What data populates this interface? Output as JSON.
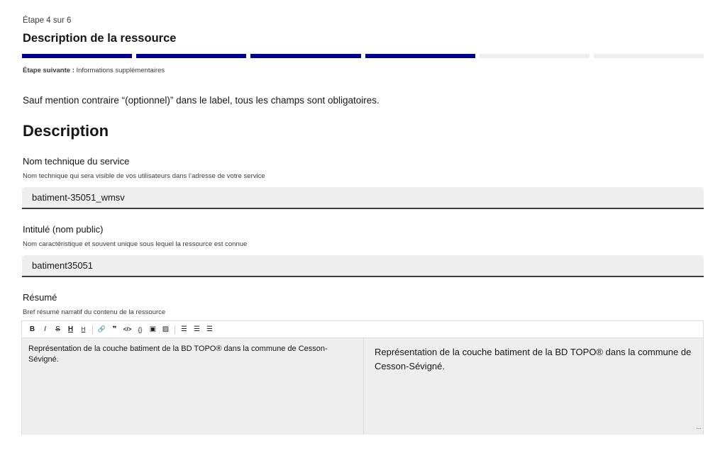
{
  "stepper": {
    "step_label": "Étape 4 sur 6",
    "title": "Description de la ressource",
    "bars": [
      {
        "state": "done"
      },
      {
        "state": "done"
      },
      {
        "state": "done"
      },
      {
        "state": "done"
      },
      {
        "state": "todo"
      },
      {
        "state": "todo"
      }
    ],
    "next_label": "Étape suivante :",
    "next_value": " Informations supplémentaires"
  },
  "mandatory_note": "Sauf mention contraire “(optionnel)” dans le label, tous les champs sont obligatoires.",
  "section_title": "Description",
  "fields": {
    "technical_name": {
      "label": "Nom technique du service",
      "hint": "Nom technique qui sera visible de vos utilisateurs dans l’adresse de votre service",
      "value": "batiment-35051_wmsv"
    },
    "public_title": {
      "label": "Intitulé (nom public)",
      "hint": "Nom caractéristique et souvent unique sous lequel la ressource est connue",
      "value": "batiment35051"
    },
    "summary": {
      "label": "Résumé",
      "hint": "Bref résumé narratif du contenu de la ressource",
      "source_text": "Représentation de la couche batiment de la BD TOPO® dans la commune de Cesson-Sévigné.",
      "preview_text": "Représentation de la couche batiment de la BD TOPO® dans la commune de Cesson-Sévigné."
    }
  },
  "editor_toolbar": [
    {
      "name": "bold-icon",
      "glyph": "B"
    },
    {
      "name": "italic-icon",
      "glyph": "I"
    },
    {
      "name": "strikethrough-icon",
      "glyph": "S"
    },
    {
      "name": "heading-icon",
      "glyph": "H"
    },
    {
      "name": "heading-small-icon",
      "glyph": "H"
    },
    {
      "name": "link-icon",
      "glyph": "🔗"
    },
    {
      "name": "quote-icon",
      "glyph": "❞"
    },
    {
      "name": "code-icon",
      "glyph": "</>"
    },
    {
      "name": "code-block-icon",
      "glyph": "{}"
    },
    {
      "name": "embed-icon",
      "glyph": "▣"
    },
    {
      "name": "image-icon",
      "glyph": "▨"
    },
    {
      "name": "bullet-list-icon",
      "glyph": "☰"
    },
    {
      "name": "ordered-list-icon",
      "glyph": "☰"
    },
    {
      "name": "checklist-icon",
      "glyph": "☰"
    }
  ],
  "colors": {
    "accent": "#000091",
    "field_bg": "#eeeeee",
    "text": "#161616"
  }
}
